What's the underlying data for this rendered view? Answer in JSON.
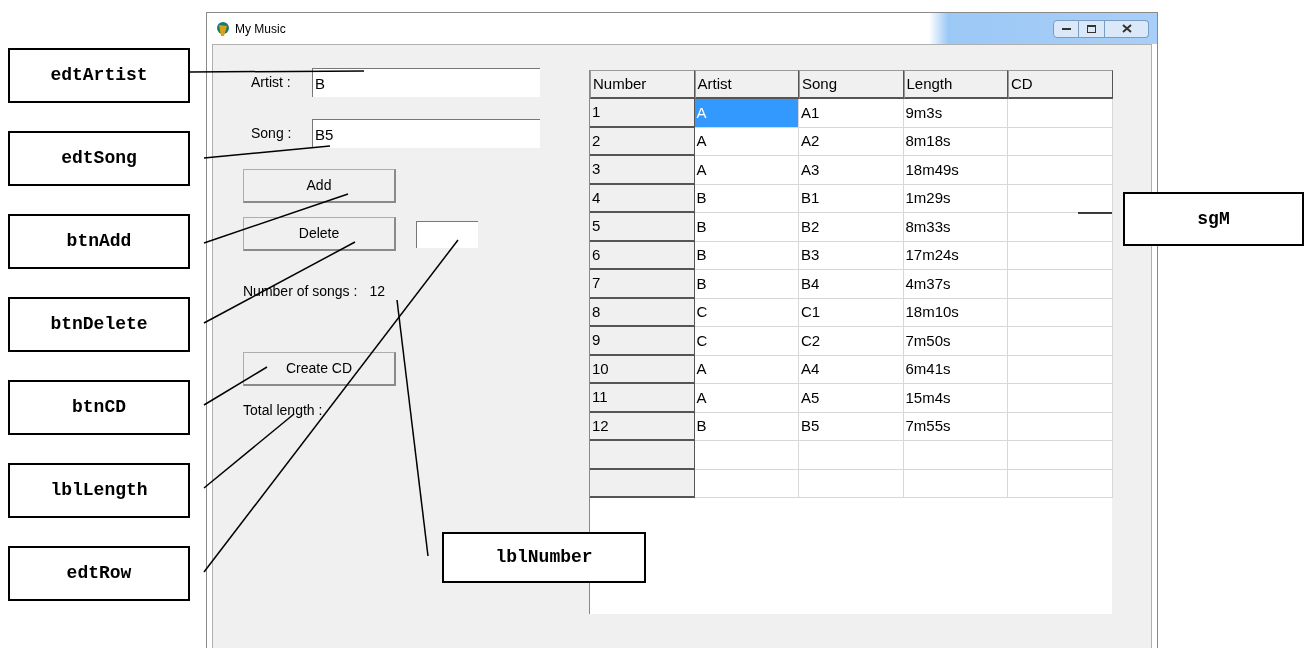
{
  "callouts": [
    {
      "text": "edtArtist",
      "kind": "left"
    },
    {
      "text": "edtSong",
      "kind": "left"
    },
    {
      "text": "btnAdd",
      "kind": "left"
    },
    {
      "text": "btnDelete",
      "kind": "left"
    },
    {
      "text": "btnCD",
      "kind": "left"
    },
    {
      "text": "lblLength",
      "kind": "left"
    },
    {
      "text": "edtRow",
      "kind": "left"
    },
    {
      "text": "sgM",
      "kind": "right"
    },
    {
      "text": "lblNumber",
      "kind": "bottom"
    }
  ],
  "window": {
    "title": "My Music"
  },
  "form": {
    "artist": {
      "label": "Artist :",
      "value": "B"
    },
    "song": {
      "label": "Song :",
      "value": "B5"
    },
    "add_button": "Add",
    "delete_button": "Delete",
    "songs_label": "Number of songs :",
    "songs_count": "12",
    "cd_button": "Create CD",
    "length_label": "Total length :"
  },
  "grid": {
    "columns": [
      "Number",
      "Artist",
      "Song",
      "Length",
      "CD"
    ],
    "rows": [
      {
        "cells": [
          {
            "text": "1",
            "selected": false
          },
          {
            "text": "A",
            "selected": true
          },
          {
            "text": "A1",
            "selected": false
          },
          {
            "text": "9m3s",
            "selected": false
          }
        ]
      },
      {
        "cells": [
          {
            "text": "2",
            "selected": false
          },
          {
            "text": "A",
            "selected": false
          },
          {
            "text": "A2",
            "selected": false
          },
          {
            "text": "8m18s",
            "selected": false
          }
        ]
      },
      {
        "cells": [
          {
            "text": "3",
            "selected": false
          },
          {
            "text": "A",
            "selected": false
          },
          {
            "text": "A3",
            "selected": false
          },
          {
            "text": "18m49s",
            "selected": false
          }
        ]
      },
      {
        "cells": [
          {
            "text": "4",
            "selected": false
          },
          {
            "text": "B",
            "selected": false
          },
          {
            "text": "B1",
            "selected": false
          },
          {
            "text": "1m29s",
            "selected": false
          }
        ]
      },
      {
        "cells": [
          {
            "text": "5",
            "selected": false
          },
          {
            "text": "B",
            "selected": false
          },
          {
            "text": "B2",
            "selected": false
          },
          {
            "text": "8m33s",
            "selected": false
          }
        ]
      },
      {
        "cells": [
          {
            "text": "6",
            "selected": false
          },
          {
            "text": "B",
            "selected": false
          },
          {
            "text": "B3",
            "selected": false
          },
          {
            "text": "17m24s",
            "selected": false
          }
        ]
      },
      {
        "cells": [
          {
            "text": "7",
            "selected": false
          },
          {
            "text": "B",
            "selected": false
          },
          {
            "text": "B4",
            "selected": false
          },
          {
            "text": "4m37s",
            "selected": false
          }
        ]
      },
      {
        "cells": [
          {
            "text": "8",
            "selected": false
          },
          {
            "text": "C",
            "selected": false
          },
          {
            "text": "C1",
            "selected": false
          },
          {
            "text": "18m10s",
            "selected": false
          }
        ]
      },
      {
        "cells": [
          {
            "text": "9",
            "selected": false
          },
          {
            "text": "C",
            "selected": false
          },
          {
            "text": "C2",
            "selected": false
          },
          {
            "text": "7m50s",
            "selected": false
          }
        ]
      },
      {
        "cells": [
          {
            "text": "10",
            "selected": false
          },
          {
            "text": "A",
            "selected": false
          },
          {
            "text": "A4",
            "selected": false
          },
          {
            "text": "6m41s",
            "selected": false
          }
        ]
      },
      {
        "cells": [
          {
            "text": "11",
            "selected": false
          },
          {
            "text": "A",
            "selected": false
          },
          {
            "text": "A5",
            "selected": false
          },
          {
            "text": "15m4s",
            "selected": false
          }
        ]
      },
      {
        "cells": [
          {
            "text": "12",
            "selected": false
          },
          {
            "text": "B",
            "selected": false
          },
          {
            "text": "B5",
            "selected": false
          },
          {
            "text": "7m55s",
            "selected": false
          }
        ]
      }
    ]
  }
}
